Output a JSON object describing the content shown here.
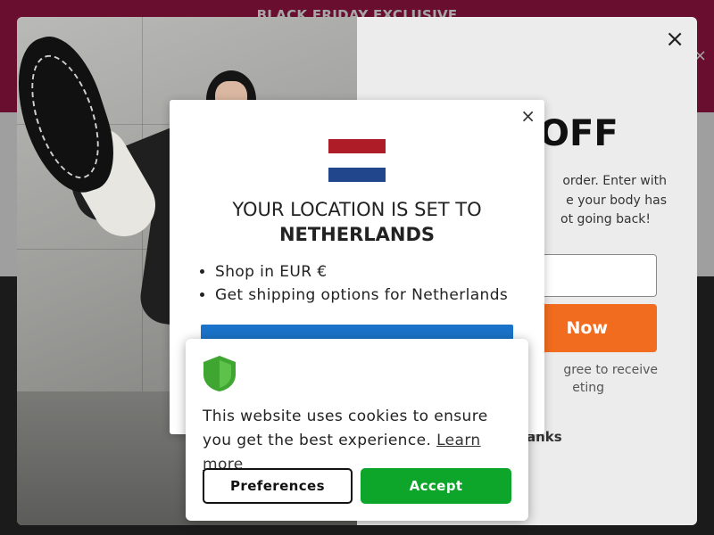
{
  "promo_bar": {
    "text": "BLACK FRIDAY EXCLUSIVE",
    "close_glyph": "×"
  },
  "email_modal": {
    "close_glyph": "×",
    "headline": "% OFF",
    "offer_text_line1": "order. Enter with",
    "offer_text_line2": "e your body has",
    "offer_text_line3": "ot going back!",
    "email_placeholder": "",
    "claim_label": "Now",
    "consent_line1": "gree to receive",
    "consent_line2": "eting",
    "no_thanks_label": "anks"
  },
  "location_modal": {
    "close_glyph": "×",
    "heading": "YOUR LOCATION IS SET TO",
    "country": "NETHERLANDS",
    "items": [
      "Shop in EUR €",
      "Get shipping options for Netherlands"
    ],
    "flag_colors": [
      "#ae1c28",
      "#ffffff",
      "#21468b"
    ],
    "button_color": "#1a73c9"
  },
  "cookie_banner": {
    "message": "This website uses cookies to ensure you get the best experience.",
    "learn_more": "Learn more",
    "preferences_label": "Preferences",
    "accept_label": "Accept",
    "accept_color": "#0da52a",
    "shield_color": "#3fa632"
  },
  "colors": {
    "promo": "#a3164a",
    "cta": "#f26c1f"
  }
}
